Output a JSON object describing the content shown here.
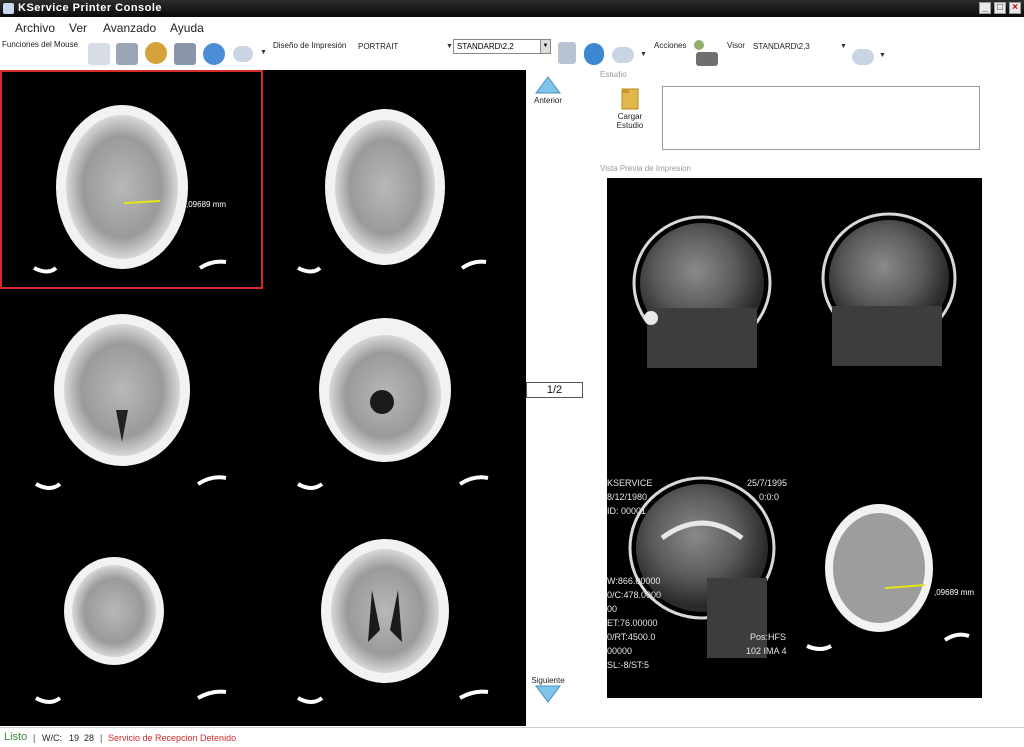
{
  "window": {
    "title": "KService Printer Console"
  },
  "menubar": {
    "items": [
      "Archivo",
      "Ver",
      "Avanzado",
      "Ayuda"
    ]
  },
  "toolbar": {
    "mouse_functions_label": "Funciones del Mouse",
    "print_layout_label": "Diseño de Impresión",
    "orientation_value": "PORTRAIT",
    "layout_value": "STANDARD\\2,2",
    "actions_label": "Acciones",
    "viewer_label": "Visor",
    "viewer_layout_value": "STANDARD\\2,3"
  },
  "viewer": {
    "measurement": ",09689 mm",
    "prev_label": "Anterior",
    "next_label": "Siguiente",
    "page": "1/2"
  },
  "study": {
    "section_label": "Estudio",
    "load_label": "Cargar Estudio"
  },
  "preview": {
    "section_label": "Vista Previa de Impresion",
    "overlay": {
      "institution": "KSERVICE",
      "study_date": "25/7/1995",
      "birth_date": "8/12/1980",
      "time": "0:0:0",
      "patient_id": "ID: 00001",
      "window_width": "W:866.00000",
      "window_center": "0/C:478.0000",
      "line3": "00",
      "echo_time": "ET:76.00000",
      "repetition": "0/RT:4500.0",
      "line6": "00000",
      "slice": "SL:-8/ST:5",
      "position": "Pos:HFS",
      "image_number": "102 IMA 4"
    },
    "measurement": ",09689 mm"
  },
  "statusbar": {
    "status": "Listo",
    "wc_label": "W/C:",
    "wc_values": "19  28",
    "service_message": "Servicio de Recepcion Detenido"
  },
  "colors": {
    "title_bar": "#1a1a1a",
    "selection_border": "#d12b2b",
    "status_ok": "#3a8a3a",
    "status_error": "#d12b2b",
    "nav_arrow": "#7ec3e8",
    "measure_line": "#e6e61a"
  }
}
